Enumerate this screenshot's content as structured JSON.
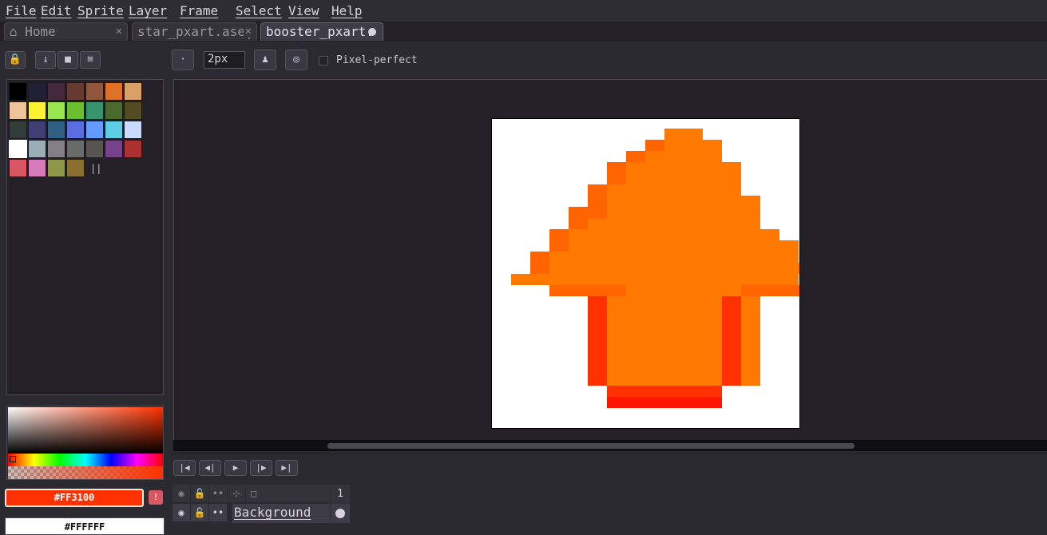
{
  "menu": [
    "File",
    "Edit",
    "Sprite",
    "Layer",
    "Frame",
    "Select",
    "View",
    "Help"
  ],
  "tabs": [
    {
      "label": "Home",
      "icon": "home-icon",
      "active": false
    },
    {
      "label": "star_pxart.ase|",
      "active": false
    },
    {
      "label": "booster_pxart.",
      "active": true,
      "modified": true
    }
  ],
  "palette": {
    "colors": [
      "#000000",
      "#222034",
      "#45283c",
      "#663931",
      "#8f563b",
      "#df7126",
      "#d9a066",
      "#eec39a",
      "#fbf236",
      "#99e550",
      "#6abe30",
      "#37946e",
      "#4b692f",
      "#524b24",
      "#323c39",
      "#3f3f74",
      "#306082",
      "#5b6ee1",
      "#639bff",
      "#5fcde4",
      "#cbdbfc",
      "#ffffff",
      "#9badb7",
      "#847e87",
      "#696a6a",
      "#595652",
      "#76428a",
      "#ac3232",
      "#d95763",
      "#d77bba",
      "#8f974a",
      "#8a6f30"
    ],
    "selected_index": 21
  },
  "color_bar": {
    "fg_hex": "#FF3100",
    "bg_hex": "#FFFFFF"
  },
  "brush": {
    "size": "2px",
    "pixel_perfect_label": "Pixel-perfect",
    "pixel_perfect": false
  },
  "sprite": {
    "background": "#ffffff",
    "colors": {
      "o": "#ff7800",
      "d": "#ff6400",
      "r": "#ff3100",
      "f": "#ff1500"
    },
    "grid_w": 16,
    "rows": [
      "........oo......",
      ".......dooo.....",
      "......doooo.....",
      ".....doooooo....",
      ".....doooooo....",
      "....dooooooo....",
      "....doooooooo...",
      "...ddoooooooo...",
      "...dooooooooo...",
      "..dooooooooooo..",
      "..doooooooooooo.",
      ".dooooooooooooo.",
      ".doooooooooooooo",
      "ooooooooooooooo.",
      "..ddddoooooodddd",
      "....rooooooro...",
      "....rooooooro...",
      "....rooooooro...",
      "....rooooooro...",
      "....rooooooro...",
      "....rooooooro...",
      "....rooooooro...",
      "....rooooooro...",
      ".....rrrrrr.....",
      ".....ffffff....."
    ]
  },
  "timeline": {
    "layer_name": "Background",
    "frame_number": "1"
  }
}
